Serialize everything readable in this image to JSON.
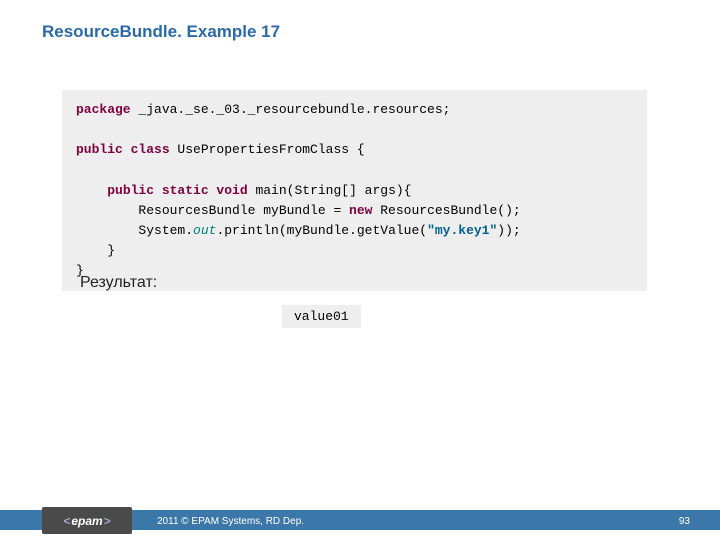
{
  "title": "ResourceBundle. Example 17",
  "code": {
    "l1a": "package",
    "l1b": " _java._se._03._resourcebundle.resources;",
    "l2a": "public class",
    "l2b": " UsePropertiesFromClass {",
    "l3a": "    ",
    "l3b": "public static void",
    "l3c": " main(String[] args){",
    "l4a": "        ResourcesBundle myBundle = ",
    "l4b": "new",
    "l4c": " ResourcesBundle();",
    "l5a": "        System.",
    "l5b": "out",
    "l5c": ".println(myBundle.getValue(",
    "l5d": "\"my.key1\"",
    "l5e": "));",
    "l6": "    }",
    "l7": "}"
  },
  "result_label": "Результат:",
  "result_value": "value01",
  "footer": {
    "logo": "epam",
    "copyright": "2011 © EPAM Systems, RD Dep.",
    "page": "93"
  }
}
